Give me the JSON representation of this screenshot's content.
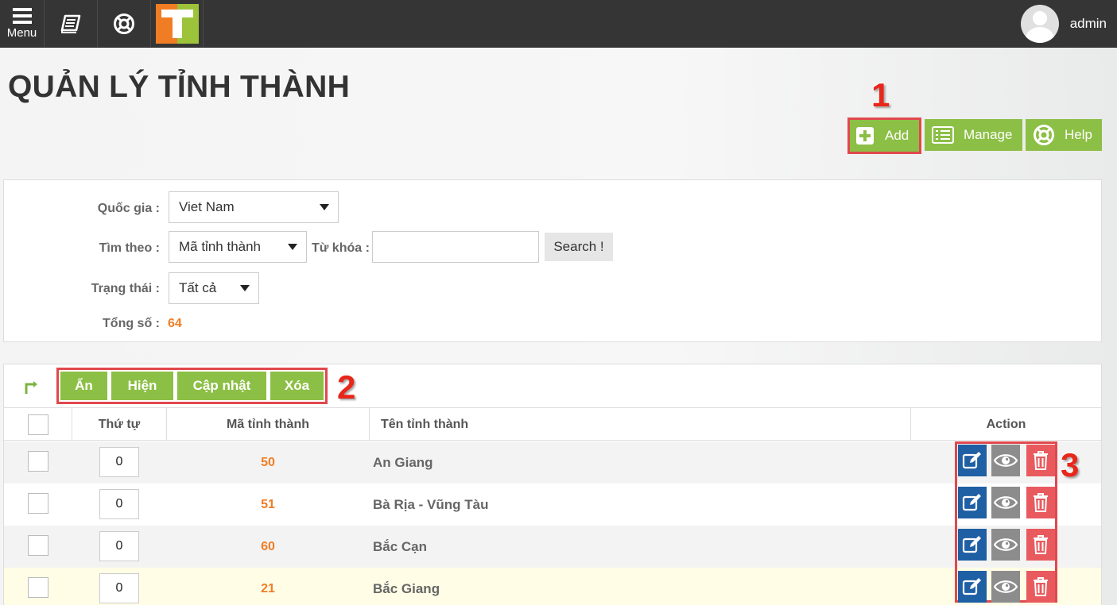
{
  "topbar": {
    "menu_label": "Menu",
    "username": "admin"
  },
  "page": {
    "title": "QUẢN LÝ TỈNH THÀNH"
  },
  "toolbar": {
    "add_label": "Add",
    "manage_label": "Manage",
    "help_label": "Help"
  },
  "callouts": [
    "1",
    "2",
    "3"
  ],
  "filters": {
    "country_label": "Quốc gia :",
    "country_value": "Viet Nam",
    "search_by_label": "Tìm theo :",
    "search_by_value": "Mã tỉnh thành",
    "keyword_label": "Từ khóa :",
    "keyword_value": "",
    "search_button": "Search !",
    "status_label": "Trạng thái :",
    "status_value": "Tất cả",
    "total_label": "Tổng số :",
    "total_value": "64"
  },
  "bulk_actions": [
    "Ẩn",
    "Hiện",
    "Cập nhật",
    "Xóa"
  ],
  "table": {
    "headers": {
      "order": "Thứ tự",
      "code": "Mã tỉnh thành",
      "name": "Tên tỉnh thành",
      "action": "Action"
    },
    "rows": [
      {
        "order": "0",
        "code": "50",
        "name": "An Giang"
      },
      {
        "order": "0",
        "code": "51",
        "name": "Bà Rịa - Vũng Tàu"
      },
      {
        "order": "0",
        "code": "60",
        "name": "Bắc Cạn"
      },
      {
        "order": "0",
        "code": "21",
        "name": "Bắc Giang"
      }
    ]
  },
  "colors": {
    "accent_green": "#8cbf45",
    "accent_orange": "#f07d24",
    "edit_blue": "#1f5fa3",
    "view_gray": "#8c8c8c",
    "delete_red": "#e85a5e",
    "highlight_red": "#e0484d",
    "topbar_bg": "#353535"
  },
  "icons": {
    "menu": "hamburger-icon",
    "book": "book-icon",
    "support": "lifebuoy-icon",
    "add": "plus-icon",
    "manage": "list-icon",
    "help": "lifebuoy-icon",
    "edit": "edit-icon",
    "view": "eye-icon",
    "delete": "trash-icon"
  }
}
